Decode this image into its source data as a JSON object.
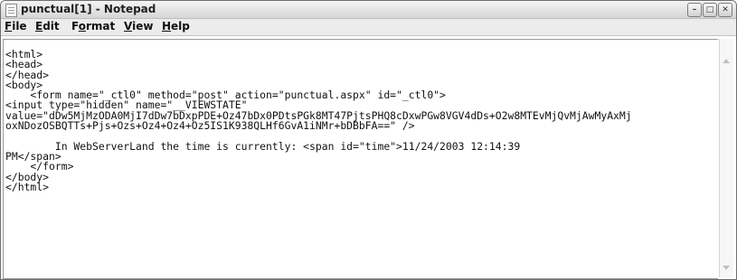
{
  "window": {
    "title": "punctual[1] - Notepad"
  },
  "menu": [
    {
      "pre": "",
      "key": "F",
      "post": "ile"
    },
    {
      "pre": "",
      "key": "E",
      "post": "dit"
    },
    {
      "pre": "F",
      "key": "o",
      "post": "rmat"
    },
    {
      "pre": "",
      "key": "V",
      "post": "iew"
    },
    {
      "pre": "",
      "key": "H",
      "post": "elp"
    }
  ],
  "document": {
    "lines": [
      "<html>",
      "<head>",
      "</head>",
      "<body>",
      "    <form name=\"_ctl0\" method=\"post\" action=\"punctual.aspx\" id=\"_ctl0\">",
      "<input type=\"hidden\" name=\"__VIEWSTATE\"",
      "value=\"dDw5MjMzODA0MjI7dDw7bDxpPDE+Oz47bDx0PDtsPGk8MT47PjtsPHQ8cDxwPGw8VGV4dDs+O2w8MTEvMjQvMjAwMyAxMjoxNDozOSBQTTs+Pjs+Ozs+Oz4+Oz4+Oz5IS1K938QLHf6GvA1iNMr+bDBbFA==\" />",
      "",
      "        In WebServerLand the time is currently: <span id=\"time\">11/24/2003 12:14:39",
      "PM</span>",
      "    </form>",
      "</body>",
      "</html>"
    ]
  },
  "icons": {
    "app": "notepad-icon",
    "minimize": "minimize-icon",
    "maximize": "maximize-icon",
    "close": "close-icon",
    "scroll_up": "scroll-up-arrow-icon",
    "scroll_down": "scroll-down-arrow-icon"
  }
}
